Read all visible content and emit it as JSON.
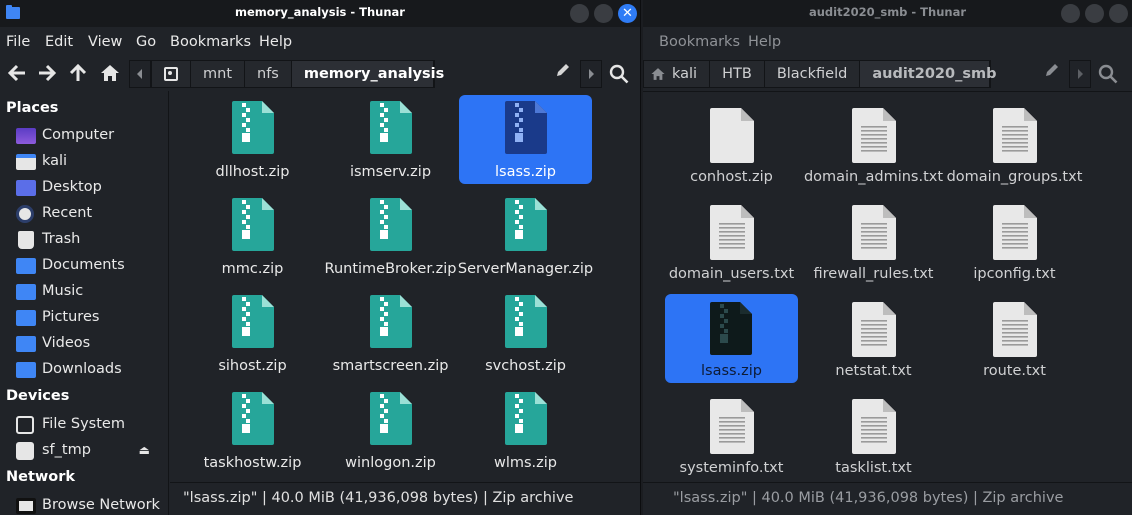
{
  "left_window": {
    "title": "memory_analysis - Thunar",
    "menu": [
      "File",
      "Edit",
      "View",
      "Go",
      "Bookmarks",
      "Help"
    ],
    "breadcrumbs": [
      "mnt",
      "nfs",
      "memory_analysis"
    ],
    "sidebar": {
      "places_heading": "Places",
      "places": [
        {
          "label": "Computer",
          "icon": "computer-icon",
          "color": "#7c4dd8"
        },
        {
          "label": "kali",
          "icon": "home-folder-icon",
          "color": "#e6e6e6"
        },
        {
          "label": "Desktop",
          "icon": "desktop-folder-icon",
          "color": "#5b6ee8"
        },
        {
          "label": "Recent",
          "icon": "recent-icon",
          "color": "#e6e6e6"
        },
        {
          "label": "Trash",
          "icon": "trash-icon",
          "color": "#e6e6e6"
        },
        {
          "label": "Documents",
          "icon": "documents-folder-icon",
          "color": "#3f86f5"
        },
        {
          "label": "Music",
          "icon": "music-folder-icon",
          "color": "#3f86f5"
        },
        {
          "label": "Pictures",
          "icon": "pictures-folder-icon",
          "color": "#3f86f5"
        },
        {
          "label": "Videos",
          "icon": "videos-folder-icon",
          "color": "#3f86f5"
        },
        {
          "label": "Downloads",
          "icon": "downloads-folder-icon",
          "color": "#3f86f5"
        }
      ],
      "devices_heading": "Devices",
      "devices": [
        {
          "label": "File System",
          "icon": "filesystem-icon"
        },
        {
          "label": "sf_tmp",
          "icon": "drive-icon"
        }
      ],
      "network_heading": "Network",
      "network": [
        {
          "label": "Browse Network",
          "icon": "network-icon"
        }
      ]
    },
    "files": [
      {
        "name": "dllhost.zip",
        "selected": false
      },
      {
        "name": "ismserv.zip",
        "selected": false
      },
      {
        "name": "lsass.zip",
        "selected": true
      },
      {
        "name": "mmc.zip",
        "selected": false
      },
      {
        "name": "RuntimeBroker.zip",
        "selected": false
      },
      {
        "name": "ServerManager.zip",
        "selected": false
      },
      {
        "name": "sihost.zip",
        "selected": false
      },
      {
        "name": "smartscreen.zip",
        "selected": false
      },
      {
        "name": "svchost.zip",
        "selected": false
      },
      {
        "name": "taskhostw.zip",
        "selected": false
      },
      {
        "name": "winlogon.zip",
        "selected": false
      },
      {
        "name": "wlms.zip",
        "selected": false
      }
    ],
    "status": "\"lsass.zip\" | 40.0 MiB (41,936,098 bytes) | Zip archive",
    "colors": {
      "zip": "#26a69a",
      "selection": "#2d74f5"
    }
  },
  "right_window": {
    "title": "audit2020_smb - Thunar",
    "menu": [
      "Bookmarks",
      "Help"
    ],
    "breadcrumbs": [
      "kali",
      "HTB",
      "Blackfield",
      "audit2020_smb"
    ],
    "files": [
      {
        "name": "conhost.zip",
        "kind": "doc",
        "selected": false
      },
      {
        "name": "domain_admins.txt",
        "kind": "txt",
        "selected": false
      },
      {
        "name": "domain_groups.txt",
        "kind": "txt",
        "selected": false
      },
      {
        "name": "domain_users.txt",
        "kind": "txt",
        "selected": false
      },
      {
        "name": "firewall_rules.txt",
        "kind": "txt",
        "selected": false
      },
      {
        "name": "ipconfig.txt",
        "kind": "txt",
        "selected": false
      },
      {
        "name": "lsass.zip",
        "kind": "zip",
        "selected": true
      },
      {
        "name": "netstat.txt",
        "kind": "txt",
        "selected": false
      },
      {
        "name": "route.txt",
        "kind": "txt",
        "selected": false
      },
      {
        "name": "systeminfo.txt",
        "kind": "txt",
        "selected": false
      },
      {
        "name": "tasklist.txt",
        "kind": "txt",
        "selected": false
      }
    ],
    "status": "\"lsass.zip\" | 40.0 MiB (41,936,098 bytes) | Zip archive"
  }
}
